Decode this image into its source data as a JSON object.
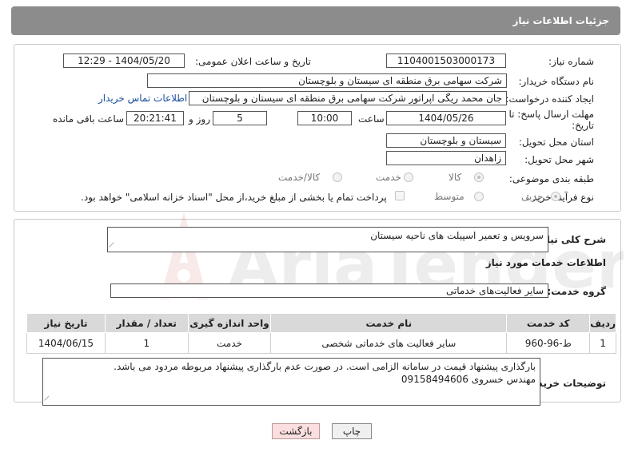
{
  "header": {
    "title": "جزئیات اطلاعات نیاز"
  },
  "fields": {
    "need_number_label": "شماره نیاز:",
    "need_number": "1104001503000173",
    "announce_label": "تاریخ و ساعت اعلان عمومی:",
    "announce_value": "1404/05/20 - 12:29",
    "buyer_org_label": "نام دستگاه خریدار:",
    "buyer_org": "شرکت سهامی برق منطقه ای سیستان و بلوچستان",
    "requester_label": "ایجاد کننده درخواست:",
    "requester": "جان محمد ریگی اپراتور شرکت سهامی برق منطقه ای سیستان و بلوچستان",
    "contact_link": "اطلاعات تماس خریدار",
    "deadline_label_1": "مهلت ارسال پاسخ: تا",
    "deadline_label_2": "تاریخ:",
    "deadline_date": "1404/05/26",
    "time_label": "ساعت",
    "deadline_time": "10:00",
    "days_value": "5",
    "days_label": "روز و",
    "remaining_time": "20:21:41",
    "remaining_label": "ساعت باقی مانده",
    "province_label": "استان محل تحویل:",
    "province": "سیستان و بلوچستان",
    "city_label": "شهر محل تحویل:",
    "city": "زاهدان",
    "category_label": "طبقه بندی موضوعی:",
    "category_options": [
      "کالا",
      "خدمت",
      "کالا/خدمت"
    ],
    "process_label": "نوع فرآیند خرید :",
    "process_options": [
      "جزیی",
      "متوسط"
    ],
    "payment_note": "پرداخت تمام یا بخشی از مبلغ خرید،از محل \"اسناد خزانه اسلامی\" خواهد بود."
  },
  "details": {
    "summary_label": "شرح کلی نیاز:",
    "summary_text": "سرویس و تعمیر اسپیلت های  ناحیه سیستان",
    "services_heading": "اطلاعات خدمات مورد نیاز",
    "service_group_label": "گروه خدمت:",
    "service_group": "سایر فعالیت‌های خدماتی",
    "buyer_notes_label": "توضیحات خریدار:",
    "buyer_notes_lines": [
      "بارگذاری پیشنهاد قیمت در سامانه الزامی است. در صورت عدم بارگذاری پیشنهاد مربوطه مردود می باشد.",
      "مهندس خسروی 09158494606"
    ]
  },
  "table": {
    "headers": [
      "ردیف",
      "کد خدمت",
      "نام خدمت",
      "واحد اندازه گیری",
      "تعداد / مقدار",
      "تاریخ نیاز"
    ],
    "rows": [
      [
        "1",
        "ط-96-960",
        "سایر فعالیت های خدماتی شخصی",
        "خدمت",
        "1",
        "1404/06/15"
      ]
    ]
  },
  "buttons": {
    "print": "چاپ",
    "back": "بازگشت"
  },
  "watermark_text": "AriaTender.neT",
  "colors": {
    "header_bg": "#8c8c8c",
    "link": "#1a4fa0",
    "back_button_bg": "#fbdede",
    "watermark": "#c0392b"
  }
}
